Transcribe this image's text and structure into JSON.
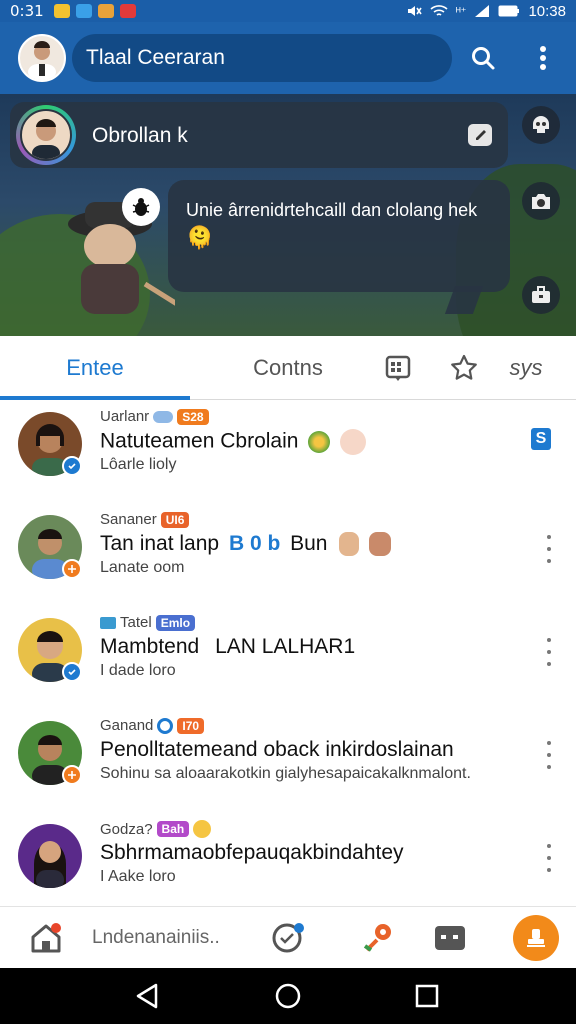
{
  "status_bar": {
    "time": "0:31",
    "clock": "10:38",
    "network": "ᴴ⁺"
  },
  "app_bar": {
    "search_text": "Tlaal Ceeraran",
    "search_icon": "search-icon",
    "menu_icon": "more-vert-icon"
  },
  "hero": {
    "header_title": "Obrollan k",
    "message": "Unie ârrenidrtehcaill dan clolang hek",
    "message_emoji": "🫠",
    "colors": {
      "card": "#28343e",
      "accent": "#1e63ad"
    }
  },
  "tabs": {
    "tab1": "Entee",
    "tab2": "Contns",
    "tab5": "sys"
  },
  "chats": [
    {
      "kicker": "Uarlanr",
      "tag": "S28",
      "tag_color": "#f07b1e",
      "name": "Natuteamen Cbrolain",
      "sub": "Lôarle lioly",
      "status_color": "#1e7ad0",
      "trailing": "S"
    },
    {
      "kicker": "Sananer",
      "tag": "UI6",
      "tag_color": "#e8632a",
      "name": "Tan inat lanp",
      "name_badge": "B 0 b",
      "name_suffix": "Bun",
      "sub": "Lanate oom",
      "status_color": "#f07b1e"
    },
    {
      "kicker": "Tatel",
      "tag": "Emlo",
      "tag_color": "#4a6fd0",
      "name": "Mambtend",
      "name_suffix": "LAN LALHAR1",
      "sub": "I dade loro",
      "status_color": "#1e7ad0"
    },
    {
      "kicker": "Ganand",
      "tag": "I70",
      "tag_color": "#ef6b2a",
      "name": "Penolltatemeand oback inkirdoslainan",
      "sub": "Sohinu sa aloaarakotkin gialyhesapaicakalknmalont.",
      "status_color": "#f07b1e"
    },
    {
      "kicker": "Godza?",
      "tag": "Bah",
      "tag_color": "#b24ac9",
      "name": "Sbhrmamaobfepauqakbindahtey",
      "sub": "I Aake loro",
      "status_color": ""
    }
  ],
  "bottom_nav": {
    "label": "Lndenanainiis.."
  }
}
